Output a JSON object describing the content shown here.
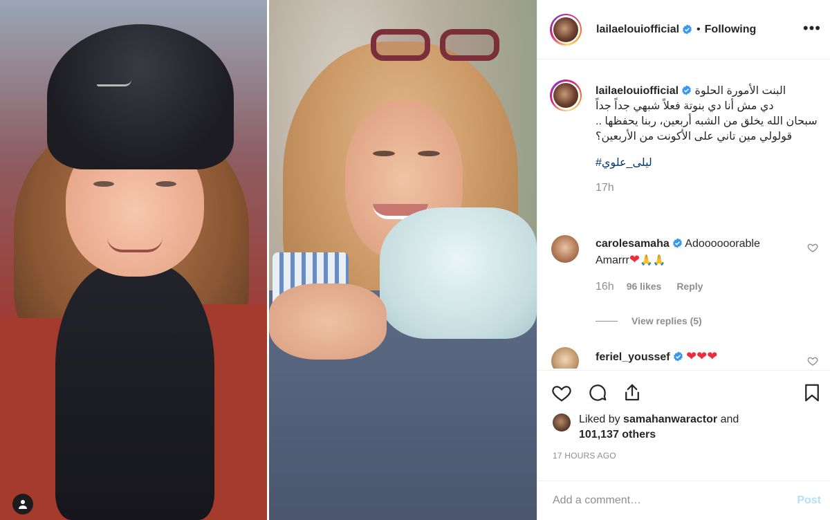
{
  "post": {
    "author": "lailaelouiofficial",
    "follow_status": "Following",
    "separator": "•",
    "more_label": "•••",
    "caption": {
      "username": "lailaelouiofficial",
      "text": "البنت الأمورة الحلوة\nدي مش أنا دي بنوتة فعلاً شبهي جداً جداً\nسبحان الله يخلق من الشبه أربعين، ربنا يحفظها .. قولولي مين تاني على الأكونت من الأربعين؟",
      "hashtag": "#ليلى_علوي",
      "time": "17h"
    },
    "comments": [
      {
        "username": "carolesamaha",
        "text": "Adoooooorable Amarrr",
        "emoji_hearts": "❤",
        "emoji_hands": "🙏🙏",
        "time": "16h",
        "likes": "96 likes",
        "reply_label": "Reply",
        "view_replies": "View replies (5)"
      },
      {
        "username": "feriel_youssef",
        "emoji_hearts": "❤❤❤"
      }
    ],
    "liked_by": {
      "prefix": "Liked by",
      "user": "samahanwaractor",
      "and": "and",
      "others": "101,137 others"
    },
    "timestamp": "17 HOURS AGO",
    "add_comment_placeholder": "Add a comment…",
    "post_button": "Post"
  },
  "colors": {
    "text": "#262626",
    "secondary": "#8e8e8e",
    "link": "#00376b",
    "verified": "#3897f0",
    "post_disabled": "#b2dffc"
  },
  "icons": {
    "verified": "verified-badge-icon",
    "like": "heart-icon",
    "comment": "comment-bubble-icon",
    "share": "share-icon",
    "save": "bookmark-icon",
    "more": "ellipsis-icon",
    "tagged": "user-tag-icon"
  }
}
